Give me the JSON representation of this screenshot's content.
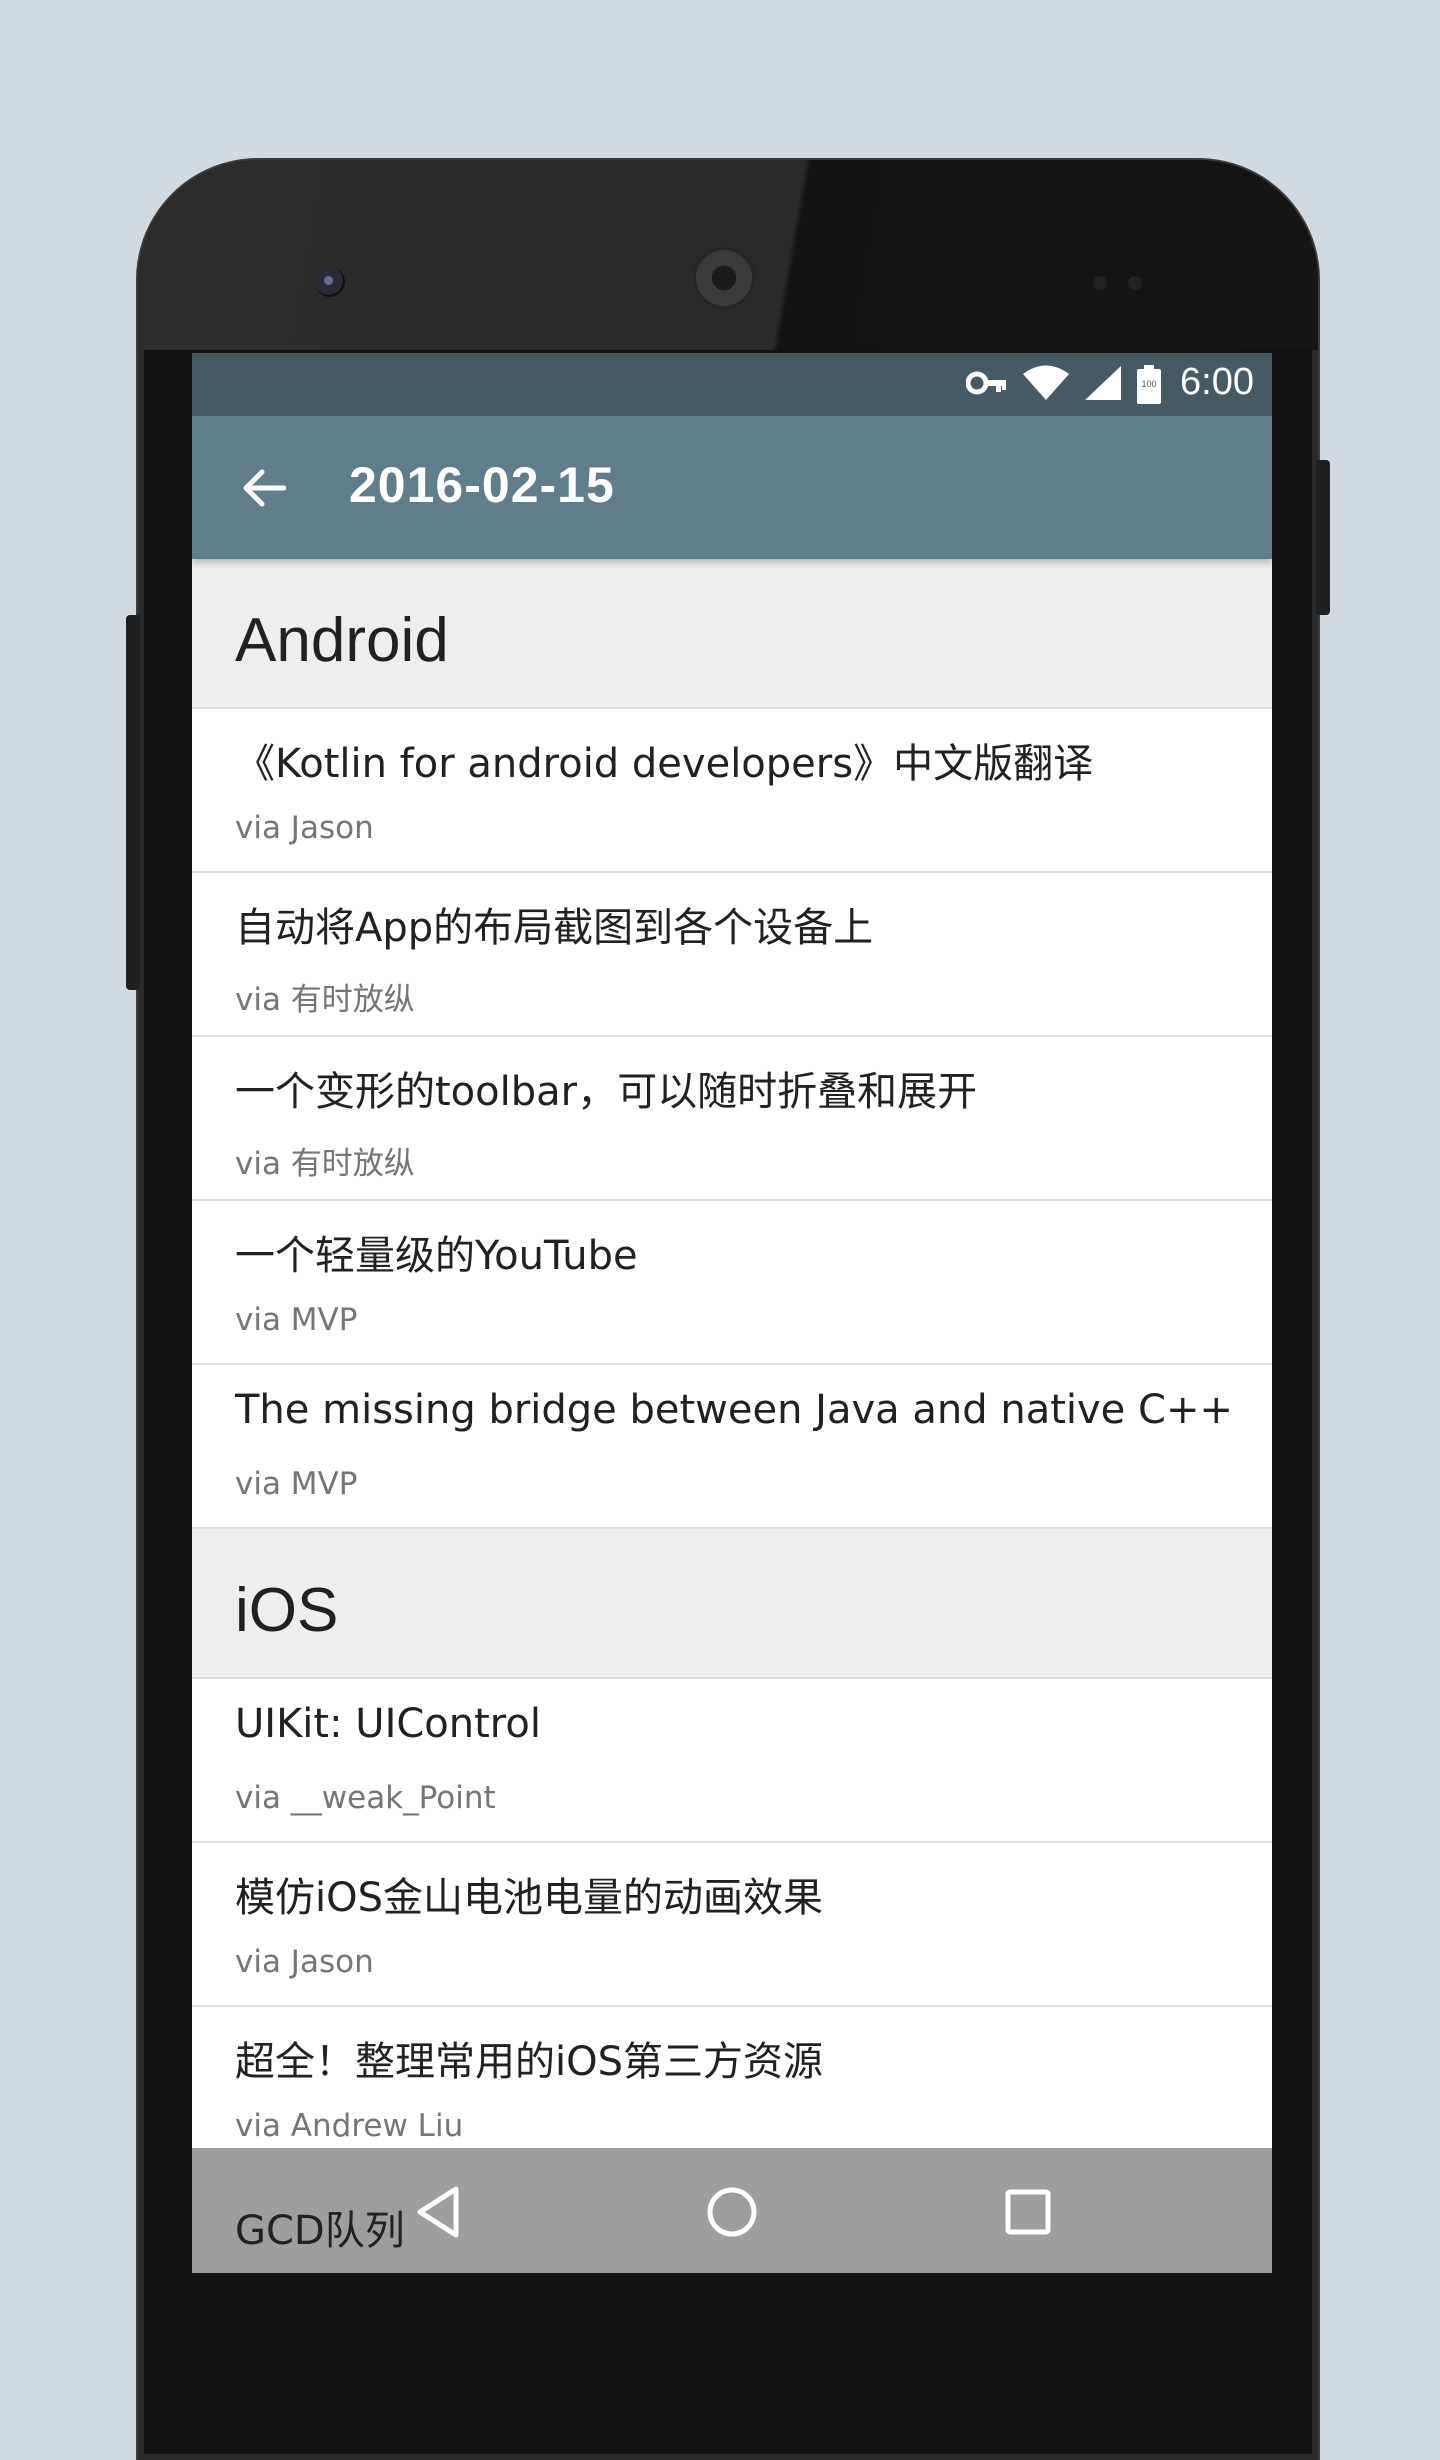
{
  "status_bar": {
    "time": "6:00",
    "battery_level": "100"
  },
  "app_bar": {
    "title": "2016-02-15"
  },
  "sections": [
    {
      "title": "Android",
      "items": [
        {
          "title": "《Kotlin for android developers》中文版翻译",
          "via": "via Jason"
        },
        {
          "title": "自动将App的布局截图到各个设备上",
          "via": "via 有时放纵"
        },
        {
          "title": "一个变形的toolbar，可以随时折叠和展开",
          "via": "via 有时放纵"
        },
        {
          "title": "一个轻量级的YouTube",
          "via": "via MVP"
        },
        {
          "title": "The missing bridge between Java and native C++",
          "via": "via MVP"
        }
      ]
    },
    {
      "title": "iOS",
      "items": [
        {
          "title": "UIKit: UIControl",
          "via": "via __weak_Point"
        },
        {
          "title": "模仿iOS金山电池电量的动画效果",
          "via": "via Jason"
        },
        {
          "title": "超全！整理常用的iOS第三方资源",
          "via": "via Andrew Liu"
        }
      ]
    }
  ],
  "nav_bar": {
    "peek_title": "GCD队列"
  },
  "colors": {
    "status_bar": "#455a64",
    "app_bar": "#607d8b",
    "section_bg": "#eeeeee",
    "background": "#d1dae0"
  },
  "icons": {
    "back": "arrow-left-icon",
    "key": "vpn-key-icon",
    "wifi": "wifi-icon",
    "signal": "cell-signal-icon",
    "battery": "battery-icon",
    "nav_back": "nav-back-icon",
    "nav_home": "nav-home-icon",
    "nav_recents": "nav-recents-icon"
  }
}
